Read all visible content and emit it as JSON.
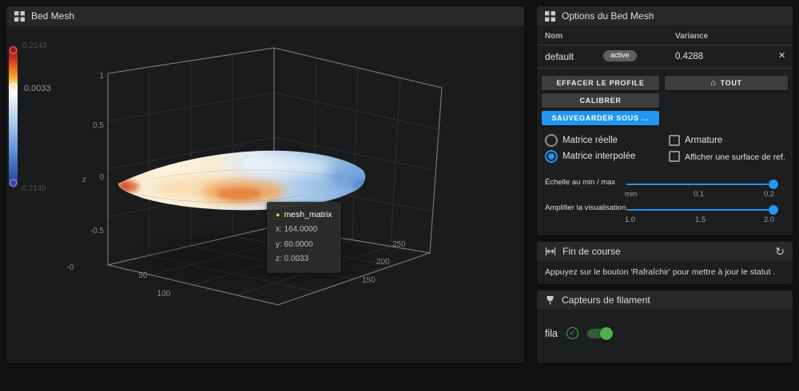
{
  "theme": {
    "accent": "#2196f3",
    "success": "#4caf50"
  },
  "icons": {
    "close": "×",
    "home": "⌂",
    "refresh": "↻",
    "check": "✓",
    "series_dot": "●"
  },
  "bed_mesh": {
    "title": "Bed Mesh",
    "colorbar": {
      "top": "0.2143",
      "marker": "0.0033",
      "bottom": "-0.2145"
    },
    "axes": {
      "z_label": "z",
      "z_ticks": [
        "1",
        "0.5",
        "0",
        "-0.5"
      ],
      "corner_tick": "-0",
      "x_ticks": [
        "50",
        "100"
      ],
      "y_ticks": [
        "150",
        "200",
        "250"
      ]
    },
    "tooltip": {
      "series": "mesh_matrix",
      "x": "x: 164.0000",
      "y": "y: 60.0000",
      "z": "z: 0.0033"
    }
  },
  "options": {
    "title": "Options du Bed Mesh",
    "table": {
      "col_name": "Nom",
      "col_variance": "Variance",
      "row": {
        "name": "default",
        "badge": "active",
        "variance": "0.4288"
      }
    },
    "buttons": {
      "clear": "EFFACER LE PROFILE",
      "all": "TOUT",
      "calibrate": "CALIBRER",
      "save": "SAUVEGARDER SOUS ..."
    },
    "radio_real": "Matrice réelle",
    "radio_interpolated": "Matrice interpolée",
    "check_wireframe": "Armature",
    "check_ref_surface": "Afficher une surface de ref.",
    "slider_scale": {
      "label": "Échelle au min / max",
      "ticks": [
        "min",
        "0.1",
        "0.2"
      ]
    },
    "slider_boost": {
      "label": "Amplifier la visualisation",
      "ticks": [
        "1.0",
        "1.5",
        "2.0"
      ]
    }
  },
  "endstops": {
    "title": "Fin de course",
    "message": "Appuyez sur le bouton 'Rafraîchir' pour mettre à jour le statut ."
  },
  "filament": {
    "title": "Capteurs de filament",
    "sensor": "fila"
  }
}
